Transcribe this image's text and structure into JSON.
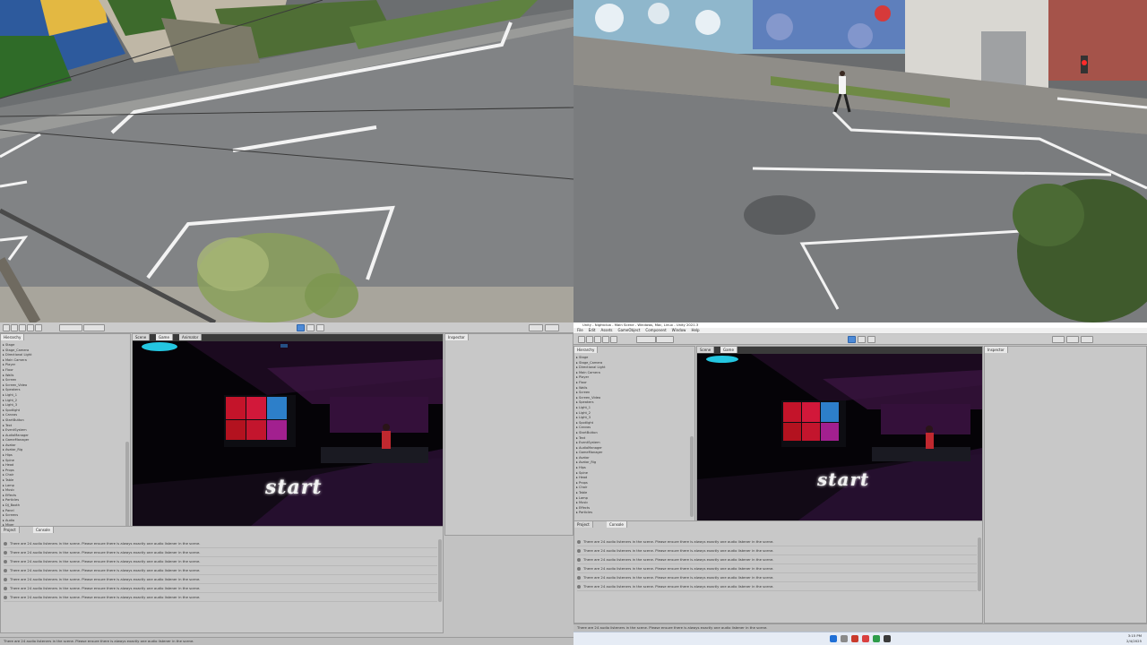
{
  "top_left_cam": {
    "description_free": true
  },
  "editor_left": {
    "toolbar_buttons": [
      "Hand",
      "Move",
      "Rotate",
      "Scale",
      "Rect",
      "Pivot",
      "Global"
    ],
    "tabs": {
      "hierarchy": "Hierarchy",
      "scene": "Scene",
      "game": "Game",
      "animator": "Animator",
      "inspector": "Inspector",
      "project": "Project",
      "console": "Console"
    },
    "hierarchy_items": [
      "Stage",
      "Stage_Camera",
      "Directional Light",
      "Main Camera",
      "Player",
      "Floor",
      "Walls",
      "Screen",
      "Screen_Video",
      "Speakers",
      "Light_1",
      "Light_2",
      "Light_3",
      "Spotlight",
      "Canvas",
      "StartButton",
      "Text",
      "EventSystem",
      "AudioManager",
      "GameManager",
      "Avatar",
      "Avatar_Rig",
      "Hips",
      "Spine",
      "Head",
      "Props",
      "Chair",
      "Table",
      "Lamp",
      "Music",
      "Effects",
      "Particles",
      "DJ_Booth",
      "Panel",
      "Screens",
      "Audio",
      "Mixer"
    ],
    "start_text": "start",
    "console_message": "There are 24 audio listeners in the scene. Please ensure there is always exactly one audio listener in the scene.",
    "status_message": "There are 24 audio listeners in the scene. Please ensure there is always exactly one audio listener in the scene."
  },
  "editor_right": {
    "window_title": "Unity - Nightclub - Main Scene - Windows, Mac, Linux - Unity 2021.3",
    "menu": [
      "File",
      "Edit",
      "Assets",
      "GameObject",
      "Component",
      "Window",
      "Help"
    ],
    "start_text": "start",
    "console_message": "There are 24 audio listeners in the scene. Please ensure there is always exactly one audio listener in the scene.",
    "status_message": "There are 24 audio listeners in the scene. Please ensure there is always exactly one audio listener in the scene.",
    "tray_time": "3:15 PM",
    "tray_date": "2/4/2025"
  },
  "colors": {
    "play_button": "#4d8ad6",
    "screen_red": "#c4142a",
    "screen_blue": "#2d7fc9",
    "dancer": "#c0282f",
    "purple_glow": "#5e1e63",
    "cyan_light": "#24c6e0"
  }
}
